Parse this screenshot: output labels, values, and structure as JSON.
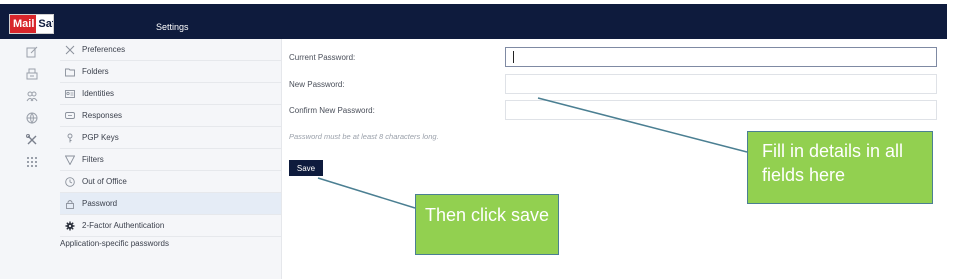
{
  "header": {
    "logo_part1": "Mail",
    "logo_part2": "Safi",
    "title": "Settings",
    "bg_color": "#0e1b3d"
  },
  "icon_rail": [
    {
      "icon": "compose-icon"
    },
    {
      "icon": "inbox-icon"
    },
    {
      "icon": "contacts-icon"
    },
    {
      "icon": "globe-icon"
    },
    {
      "icon": "settings-tools-icon"
    },
    {
      "icon": "apps-grid-icon"
    }
  ],
  "sidebar": {
    "items": [
      {
        "label": "Preferences",
        "icon": "tools-icon"
      },
      {
        "label": "Folders",
        "icon": "folder-icon"
      },
      {
        "label": "Identities",
        "icon": "identity-card-icon"
      },
      {
        "label": "Responses",
        "icon": "response-icon"
      },
      {
        "label": "PGP Keys",
        "icon": "key-icon"
      },
      {
        "label": "Filters",
        "icon": "filter-icon"
      },
      {
        "label": "Out of Office",
        "icon": "clock-icon"
      },
      {
        "label": "Password",
        "icon": "lock-icon",
        "active": true
      },
      {
        "label": "2-Factor Authentication",
        "icon": "gear-icon"
      }
    ],
    "extra_item": "Application-specific passwords",
    "active_bg": "#e5ecf6"
  },
  "form": {
    "current_password_label": "Current Password:",
    "new_password_label": "New Password:",
    "confirm_password_label": "Confirm New Password:",
    "current_password_value": "",
    "new_password_value": "",
    "confirm_password_value": "",
    "hint": "Password must be at least 8 characters long.",
    "save_label": "Save"
  },
  "callouts": {
    "fill_details": "Fill in details in all fields here",
    "then_click": "Then click save",
    "color": "#92d050"
  }
}
